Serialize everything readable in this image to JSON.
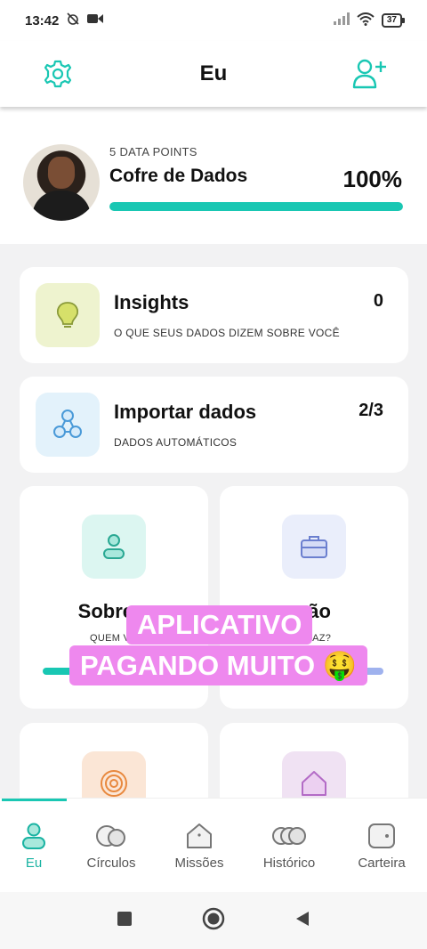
{
  "status_bar": {
    "time": "13:42",
    "battery": "37"
  },
  "header": {
    "title": "Eu"
  },
  "profile": {
    "subtitle": "5 DATA POINTS",
    "title": "Cofre de Dados",
    "percent_label": "100%",
    "progress": 1.0
  },
  "cards": {
    "insights": {
      "title": "Insights",
      "subtitle": "O QUE SEUS DADOS DIZEM SOBRE VOCÊ",
      "count": "0"
    },
    "import": {
      "title": "Importar dados",
      "subtitle": "DADOS AUTOMÁTICOS",
      "count": "2/3"
    },
    "about": {
      "title": "Sobre v",
      "subtitle": "QUEM VO"
    },
    "occupation": {
      "title": "ção",
      "subtitle": "Ê FAZ?"
    }
  },
  "overlay": {
    "line1": "APLICATIVO",
    "line2": "PAGANDO MUITO 🤑"
  },
  "nav": {
    "items": [
      {
        "label": "Eu"
      },
      {
        "label": "Círculos"
      },
      {
        "label": "Missões"
      },
      {
        "label": "Histórico"
      },
      {
        "label": "Carteira"
      }
    ]
  },
  "colors": {
    "accent": "#19c7b3",
    "overlay": "#ee88ee",
    "insights_bg": "#eef3cf",
    "import_bg": "#e3f2fb",
    "about_bg": "#dcf6f1",
    "occupation_bg": "#eaeefb",
    "target_bg": "#fbe6d6",
    "home_bg": "#f0e2f3"
  }
}
